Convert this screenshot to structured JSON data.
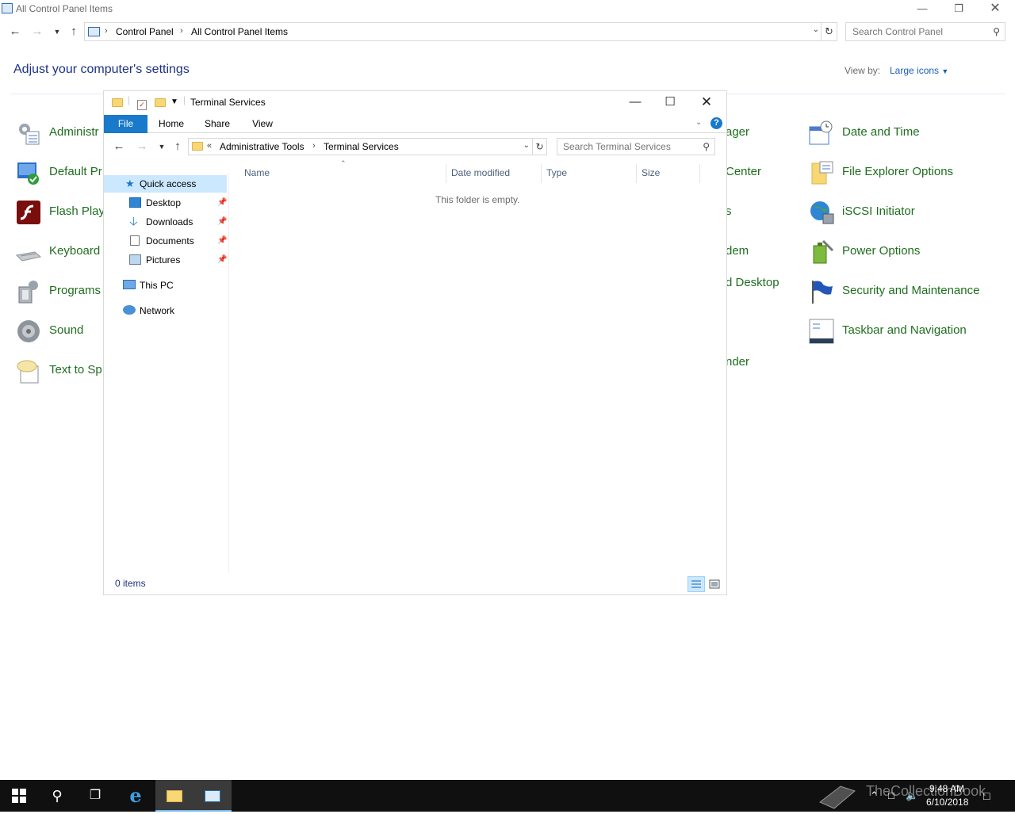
{
  "cp": {
    "window_title": "All Control Panel Items",
    "breadcrumb": [
      "Control Panel",
      "All Control Panel Items"
    ],
    "search_placeholder": "Search Control Panel",
    "heading": "Adjust your computer's settings",
    "view_by_label": "View by:",
    "view_by_value": "Large icons",
    "items_left": [
      "Administr",
      "Default Pr",
      "Flash Play",
      "Keyboard",
      "Programs",
      "Sound",
      "Text to Sp"
    ],
    "items_mid": [
      "ager",
      "Center",
      "s",
      "dem",
      "d Desktop",
      "nder"
    ],
    "items_right": [
      "Date and Time",
      "File Explorer Options",
      "iSCSI Initiator",
      "Power Options",
      "Security and Maintenance",
      "Taskbar and Navigation"
    ]
  },
  "explorer": {
    "window_title": "Terminal Services",
    "ribbon_tabs": [
      "File",
      "Home",
      "Share",
      "View"
    ],
    "breadcrumb_prefix": "«",
    "breadcrumb": [
      "Administrative Tools",
      "Terminal Services"
    ],
    "search_placeholder": "Search Terminal Services",
    "nav_pane": {
      "quick_access": "Quick access",
      "pinned": [
        "Desktop",
        "Downloads",
        "Documents",
        "Pictures"
      ],
      "this_pc": "This PC",
      "network": "Network"
    },
    "columns": [
      "Name",
      "Date modified",
      "Type",
      "Size"
    ],
    "empty_message": "This folder is empty.",
    "item_count": "0 items"
  },
  "taskbar": {
    "time": "9:48 AM",
    "date": "6/10/2018",
    "watermark": "TheCollectionBook"
  },
  "colors": {
    "accent": "#1979ca",
    "link_green": "#1e6e1e",
    "heading_blue": "#1e3287"
  }
}
